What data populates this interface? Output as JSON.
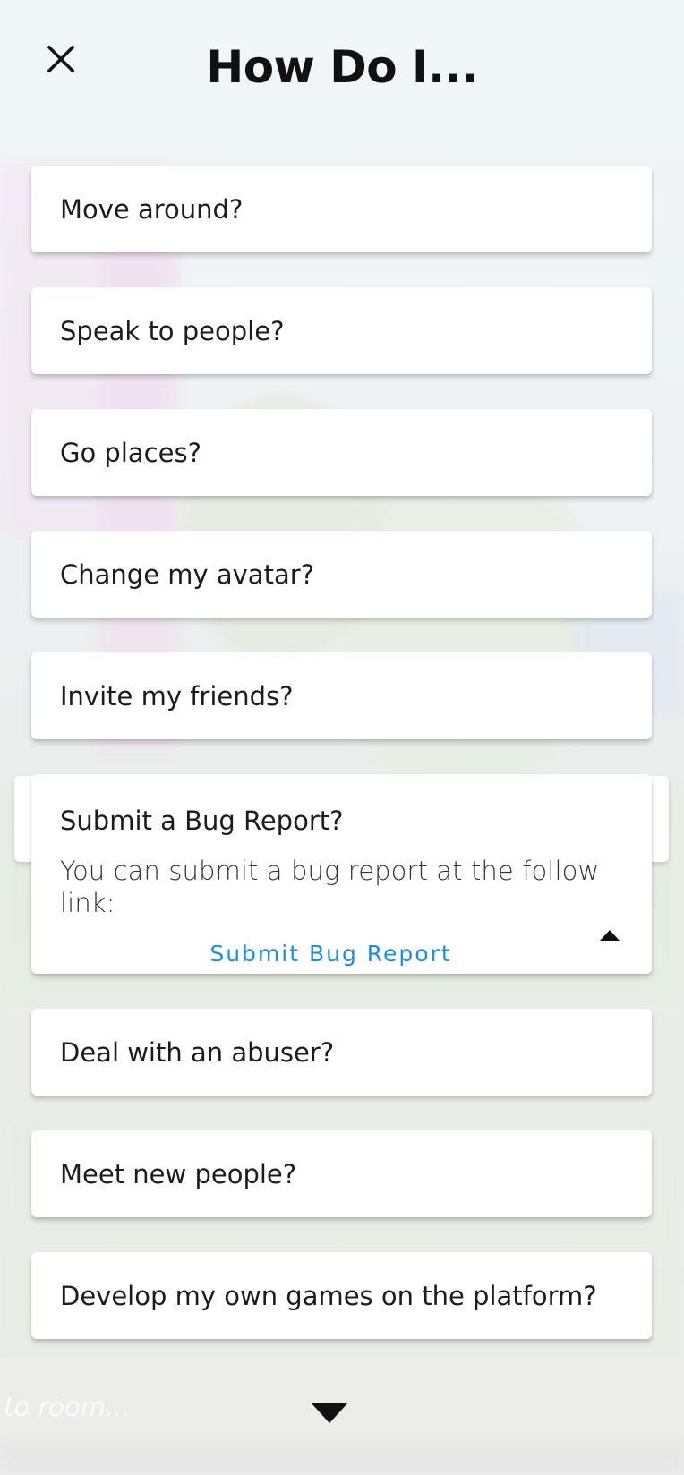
{
  "header": {
    "title": "How Do I..."
  },
  "faq": {
    "items": [
      {
        "label": "Move around?"
      },
      {
        "label": "Speak to people?"
      },
      {
        "label": "Go places?"
      },
      {
        "label": "Change my avatar?"
      },
      {
        "label": "Invite my friends?"
      }
    ],
    "expanded": {
      "label": "Submit a Bug Report?",
      "answer": "You can submit a bug report at the follow link:",
      "link_text": "Submit Bug Report"
    },
    "items_after": [
      {
        "label": "Deal with an abuser?"
      },
      {
        "label": "Meet new people?"
      },
      {
        "label": "Develop my own games on the platform?"
      }
    ]
  },
  "footer": {
    "hint_text": "to room..."
  },
  "icons": {
    "close": "close-icon",
    "collapse": "caret-up-icon",
    "scroll": "caret-down-icon"
  },
  "colors": {
    "link": "#1a8fe8",
    "card": "#ffffff",
    "title": "#111111"
  }
}
